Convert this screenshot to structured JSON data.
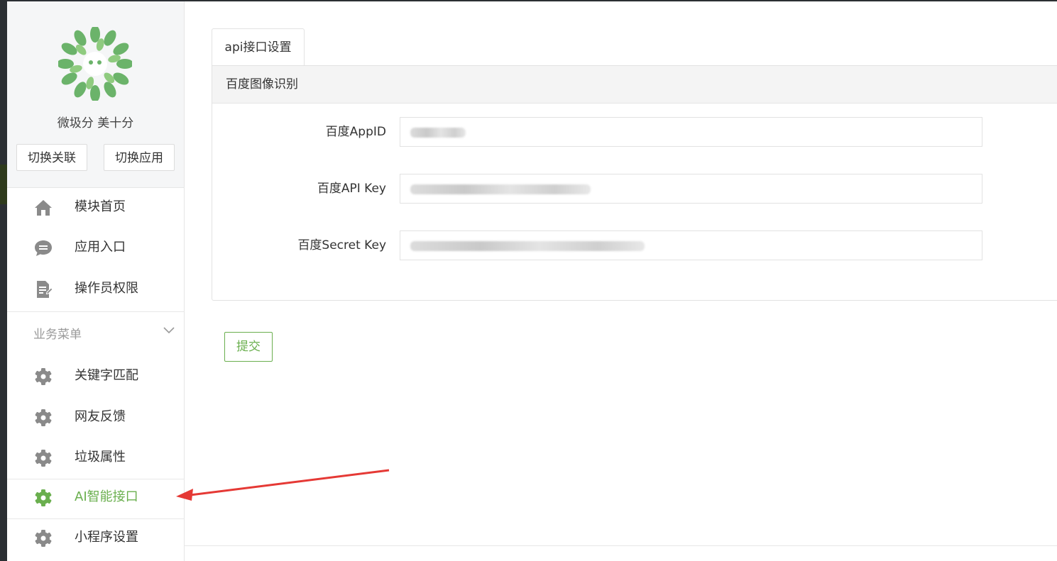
{
  "brand": {
    "name": "微圾分 美十分",
    "switch_link_label": "切换关联",
    "switch_app_label": "切换应用"
  },
  "nav": {
    "top_items": [
      {
        "label": "模块首页",
        "icon": "home-icon"
      },
      {
        "label": "应用入口",
        "icon": "chat-icon"
      },
      {
        "label": "操作员权限",
        "icon": "document-edit-icon"
      }
    ],
    "section_title": "业务菜单",
    "business_items": [
      {
        "label": "关键字匹配",
        "icon": "gear-icon"
      },
      {
        "label": "网友反馈",
        "icon": "gear-icon"
      },
      {
        "label": "垃圾属性",
        "icon": "gear-icon"
      },
      {
        "label": "AI智能接口",
        "icon": "gear-icon",
        "active": true
      },
      {
        "label": "小程序设置",
        "icon": "gear-icon"
      }
    ]
  },
  "main": {
    "tab_label": "api接口设置",
    "panel_title": "百度图像识别",
    "fields": [
      {
        "label": "百度AppID"
      },
      {
        "label": "百度API Key"
      },
      {
        "label": "百度Secret Key"
      }
    ],
    "submit_label": "提交"
  },
  "colors": {
    "accent": "#6aaf4e",
    "annotation_arrow": "#e53935"
  }
}
